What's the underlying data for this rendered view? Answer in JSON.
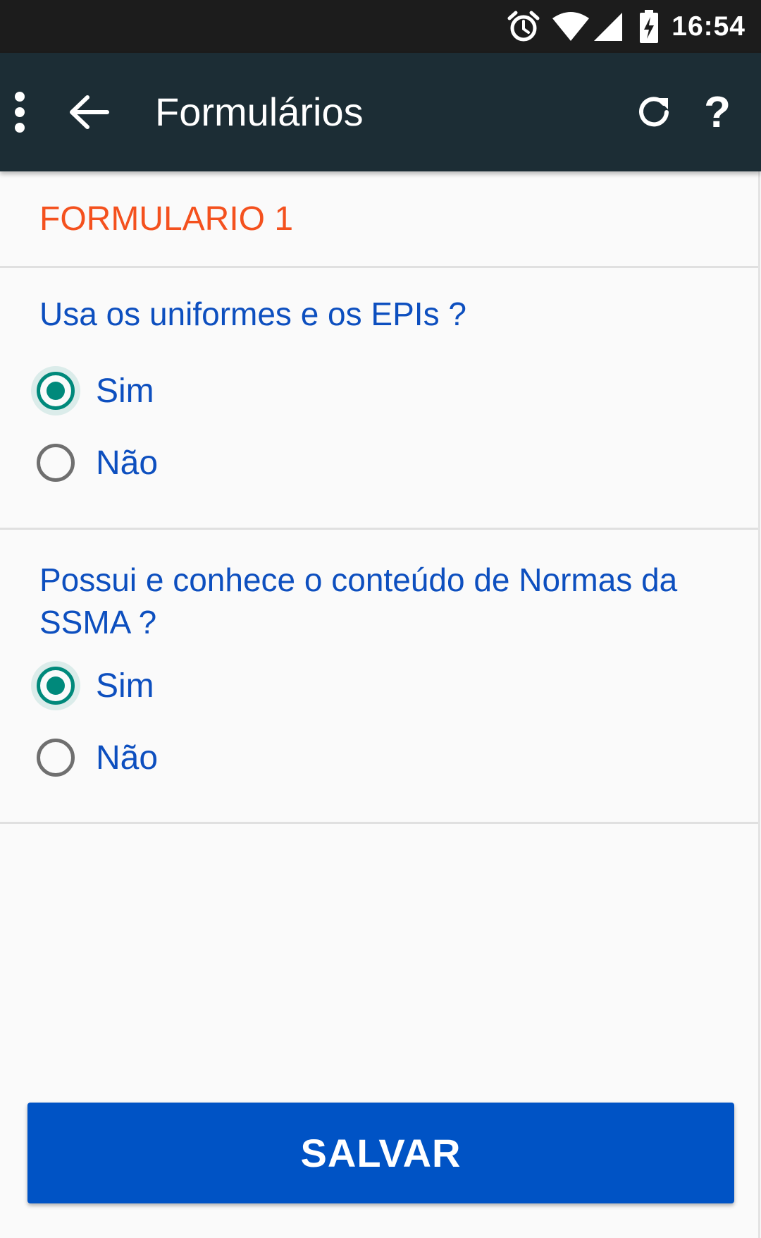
{
  "status_bar": {
    "time": "16:54",
    "icons": [
      "alarm-icon",
      "wifi-icon",
      "cell-signal-icon",
      "battery-charging-icon"
    ]
  },
  "app_bar": {
    "title": "Formulários",
    "menu_icon": "more-vert-icon",
    "back_icon": "arrow-back-icon",
    "refresh_icon": "refresh-icon",
    "help_label": "?"
  },
  "form": {
    "title": "FORMULARIO 1",
    "questions": [
      {
        "text": "Usa os uniformes e os EPIs ?",
        "options": [
          {
            "label": "Sim",
            "checked": true
          },
          {
            "label": "Não",
            "checked": false
          }
        ]
      },
      {
        "text": "Possui e conhece o conteúdo de Normas da SSMA ?",
        "options": [
          {
            "label": "Sim",
            "checked": true
          },
          {
            "label": "Não",
            "checked": false
          }
        ]
      }
    ]
  },
  "save_button": {
    "label": "SALVAR"
  },
  "colors": {
    "status_bar": "#1c1c1c",
    "app_bar": "#1c2d35",
    "form_title": "#f4511e",
    "question_text": "#0d4fbf",
    "radio_checked": "#00897b",
    "radio_unchecked": "#6f6f6f",
    "save_button": "#0053c5"
  }
}
